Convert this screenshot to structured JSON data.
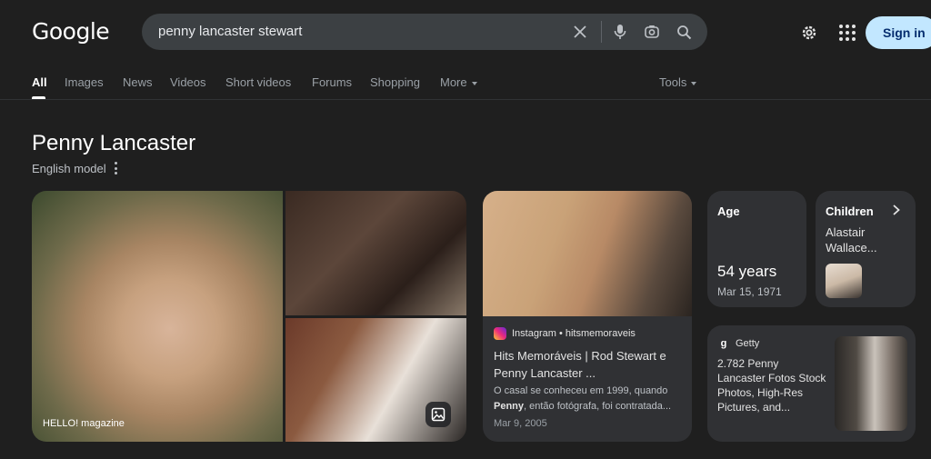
{
  "header": {
    "logo": "Google",
    "search": {
      "value": "penny lancaster stewart"
    },
    "sign_in": "Sign in",
    "icons": [
      "clear-icon",
      "microphone-icon",
      "lens-icon",
      "search-icon",
      "settings-gear-icon",
      "apps-grid-icon"
    ]
  },
  "tabs": {
    "items": [
      {
        "label": "All",
        "active": true
      },
      {
        "label": "Images"
      },
      {
        "label": "News"
      },
      {
        "label": "Videos"
      },
      {
        "label": "Short videos"
      },
      {
        "label": "Forums"
      },
      {
        "label": "Shopping"
      },
      {
        "label": "More"
      }
    ],
    "tools": "Tools"
  },
  "knowledge_panel": {
    "title": "Penny Lancaster",
    "subtitle": "English model",
    "photo_caption": "HELLO! magazine",
    "instagram_card": {
      "source": "Instagram • hitsmemoraveis",
      "title": "Hits Memoráveis | Rod Stewart e Penny Lancaster ...",
      "snippet_line1": "O casal se conheceu em 1999, quando",
      "snippet_bold": "Penny",
      "snippet_line2": ", então fotógrafa, foi contratada...",
      "date": "Mar 9, 2005"
    },
    "age_card": {
      "label": "Age",
      "value": "54 years",
      "date": "Mar 15, 1971"
    },
    "children_card": {
      "label": "Children",
      "name": "Alastair Wallace..."
    },
    "getty_card": {
      "source": "Getty",
      "title": "2.782 Penny Lancaster Fotos Stock Photos, High-Res Pictures, and..."
    }
  },
  "colors": {
    "background": "#1f1f1f",
    "search_box": "#3c4043",
    "card": "#303134",
    "sign_in_bg": "#c2e7ff",
    "sign_in_text": "#062e6f"
  }
}
